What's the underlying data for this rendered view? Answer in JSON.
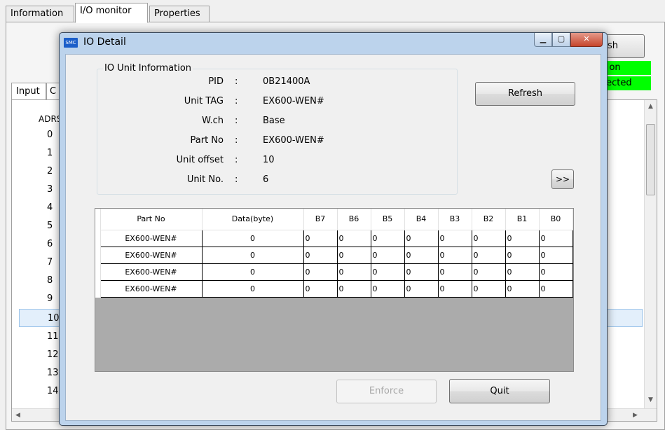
{
  "main_tabs": [
    "Information",
    "I/O monitor",
    "Properties"
  ],
  "background": {
    "refresh_label": "esh",
    "status_lines": [
      "r on",
      "tected"
    ],
    "io_tabs": [
      "Input",
      "C"
    ],
    "list_header": "ADRS",
    "rows": [
      "0",
      "1",
      "2",
      "3",
      "4",
      "5",
      "6",
      "7",
      "8",
      "9",
      "10",
      "11",
      "12",
      "13",
      "14"
    ],
    "selected_row": "10"
  },
  "dialog": {
    "title": "IO Detail",
    "icon_label": "SMC",
    "unit_info": {
      "group_title": "IO Unit Information",
      "fields": [
        {
          "label": "PID",
          "value": "0B21400A"
        },
        {
          "label": "Unit TAG",
          "value": "EX600-WEN#"
        },
        {
          "label": "W.ch",
          "value": "Base"
        },
        {
          "label": "Part No",
          "value": "EX600-WEN#"
        },
        {
          "label": "Unit offset",
          "value": "10"
        },
        {
          "label": "Unit No.",
          "value": "6"
        }
      ]
    },
    "refresh_label": "Refresh",
    "expand_label": ">>",
    "grid": {
      "columns": [
        "Part No",
        "Data(byte)",
        "B7",
        "B6",
        "B5",
        "B4",
        "B3",
        "B2",
        "B1",
        "B0"
      ],
      "rows": [
        [
          "EX600-WEN#",
          "0",
          "0",
          "0",
          "0",
          "0",
          "0",
          "0",
          "0",
          "0"
        ],
        [
          "EX600-WEN#",
          "0",
          "0",
          "0",
          "0",
          "0",
          "0",
          "0",
          "0",
          "0"
        ],
        [
          "EX600-WEN#",
          "0",
          "0",
          "0",
          "0",
          "0",
          "0",
          "0",
          "0",
          "0"
        ],
        [
          "EX600-WEN#",
          "0",
          "0",
          "0",
          "0",
          "0",
          "0",
          "0",
          "0",
          "0"
        ]
      ]
    },
    "enforce_label": "Enforce",
    "quit_label": "Quit"
  }
}
